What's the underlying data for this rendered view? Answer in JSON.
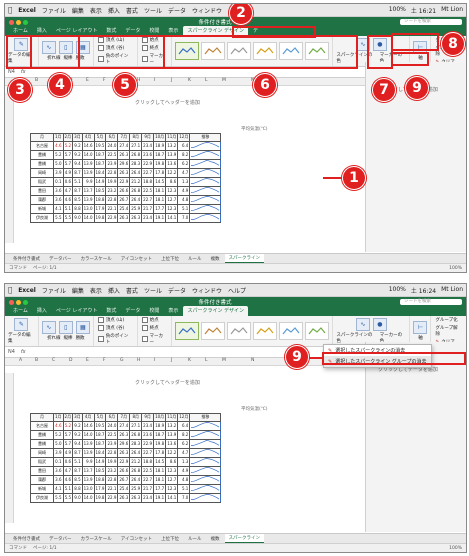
{
  "mac_menu": {
    "apple": "",
    "app": "Excel",
    "items": [
      "ファイル",
      "編集",
      "表示",
      "挿入",
      "書式",
      "ツール",
      "データ",
      "ウィンドウ",
      "ヘルプ"
    ],
    "right_panel1": [
      "100%",
      "土 16:21",
      "Mt Lion"
    ],
    "right_panel2": [
      "100%",
      "土 16:24",
      "Mt Lion"
    ]
  },
  "window": {
    "title": "条件付き書式",
    "search_placeholder": "シートを検索"
  },
  "ribbon_tabs": [
    "ホーム",
    "挿入",
    "ページ レイアウト",
    "数式",
    "データ",
    "校閲",
    "表示",
    "スパークライン デザイン"
  ],
  "ribbon_tabs_panel1_extra": "デ",
  "ribbon": {
    "edit_data": "データの編集",
    "types": [
      "折れ線",
      "縦棒",
      "勝敗"
    ],
    "checks_left": [
      "頂点 (山)",
      "頂点 (谷)",
      "負のポイント"
    ],
    "checks_right": [
      "始点",
      "終点",
      "マーカー"
    ],
    "sparkline_color": "スパークラインの色",
    "marker_color": "マーカーの色",
    "axis": "軸",
    "group": "グループ化",
    "ungroup": "グループ解除",
    "clear": "クリア",
    "colors": {
      "accent": "#1f7244",
      "spark": "#3a6fc4",
      "badge": "#e02020"
    }
  },
  "formula_bar": {
    "cell": "N4",
    "fx": "fx"
  },
  "columns": [
    "A",
    "B",
    "C",
    "D",
    "E",
    "F",
    "G",
    "H",
    "I",
    "J",
    "K",
    "L",
    "M",
    "N"
  ],
  "sheet": {
    "header_hint": "クリックしてヘッダーを追加",
    "table_title": "平均気温(℃)",
    "headers": [
      "1月",
      "2月",
      "3月",
      "4月",
      "5月",
      "6月",
      "7月",
      "8月",
      "9月",
      "10月",
      "11月",
      "12月",
      "推移"
    ],
    "month_col_header": "月",
    "rows": [
      {
        "city": "名古屋",
        "values": [
          "4.6",
          "5.2",
          "9.2",
          "14.6",
          "19.5",
          "24.0",
          "27.4",
          "27.1",
          "23.4",
          "18.9",
          "13.2",
          "6.4"
        ],
        "red": true
      },
      {
        "city": "豊橋",
        "values": [
          "5.2",
          "5.7",
          "9.2",
          "14.0",
          "18.7",
          "22.5",
          "26.3",
          "26.8",
          "23.6",
          "18.7",
          "13.9",
          "8.2"
        ],
        "red": false
      },
      {
        "city": "豊橋",
        "values": [
          "5.0",
          "5.7",
          "9.4",
          "13.9",
          "18.7",
          "23.9",
          "29.6",
          "28.3",
          "22.9",
          "19.8",
          "13.6",
          "6.2"
        ],
        "red": false
      },
      {
        "city": "岡崎",
        "values": [
          "3.9",
          "4.9",
          "8.7",
          "13.9",
          "18.4",
          "22.8",
          "26.3",
          "26.4",
          "22.7",
          "17.8",
          "12.2",
          "4.7"
        ],
        "red": false
      },
      {
        "city": "稲武",
        "values": [
          "0.1",
          "0.6",
          "5.1",
          "9.9",
          "14.9",
          "19.9",
          "22.9",
          "21.2",
          "18.8",
          "14.5",
          "8.6",
          "1.3"
        ],
        "red": false
      },
      {
        "city": "豊田",
        "values": [
          "3.6",
          "4.7",
          "8.7",
          "13.7",
          "18.5",
          "23.2",
          "26.6",
          "26.8",
          "22.5",
          "18.1",
          "12.3",
          "4.9"
        ],
        "red": false
      },
      {
        "city": "蒲郡",
        "values": [
          "3.6",
          "4.6",
          "8.5",
          "13.9",
          "18.8",
          "22.8",
          "26.7",
          "26.4",
          "22.7",
          "18.1",
          "12.7",
          "4.8"
        ],
        "red": false
      },
      {
        "city": "新城",
        "values": [
          "4.1",
          "5.1",
          "8.8",
          "13.0",
          "17.9",
          "22.1",
          "25.4",
          "25.9",
          "21.7",
          "17.7",
          "12.3",
          "5.1"
        ],
        "red": false
      },
      {
        "city": "伊良湖",
        "values": [
          "5.5",
          "5.5",
          "9.0",
          "14.0",
          "19.8",
          "22.9",
          "26.3",
          "26.3",
          "23.4",
          "19.1",
          "14.1",
          "7.0"
        ],
        "red": false
      }
    ]
  },
  "pane_text": "クリックしてデータを追加",
  "sheet_tabs": [
    "条件付き書式",
    "データバー",
    "カラースケール",
    "アイコンセット",
    "上位下位",
    "ルール",
    "複数",
    "スパークライン"
  ],
  "status": {
    "mode": "コマンド",
    "page": "ページ: 1/1",
    "zoom": "100%"
  },
  "popup": {
    "item1": "選択したスパークラインの消去",
    "item2": "選択したスパークライン グループの消去"
  },
  "callouts": [
    "1",
    "2",
    "3",
    "4",
    "5",
    "6",
    "7",
    "8",
    "9"
  ]
}
